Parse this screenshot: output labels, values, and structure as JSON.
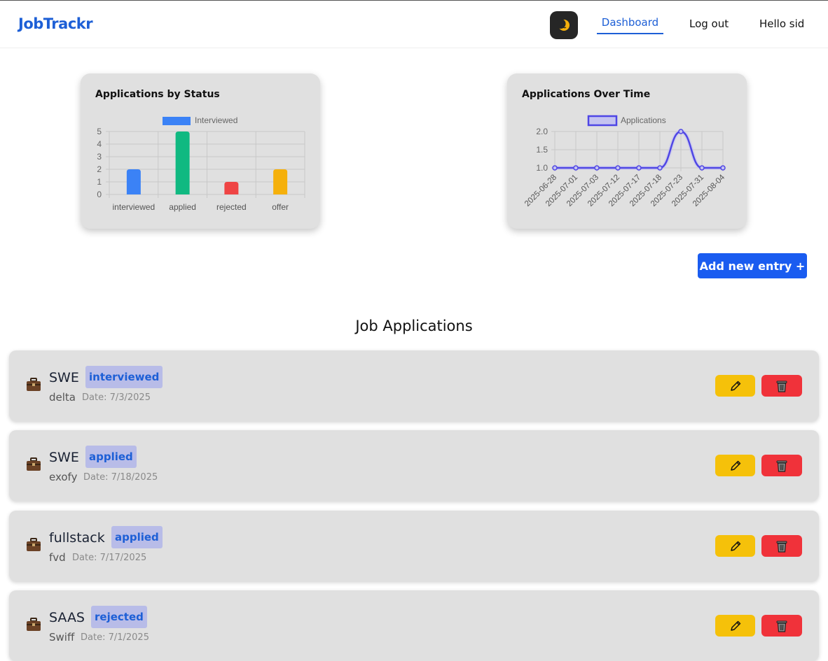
{
  "app": {
    "brand": "JobTrackr"
  },
  "nav": {
    "theme_icon": "moon-icon",
    "dashboard": "Dashboard",
    "logout": "Log out",
    "greeting": "Hello sid"
  },
  "charts": {
    "status_title": "Applications by Status",
    "time_title": "Applications Over Time"
  },
  "chart_data": [
    {
      "type": "bar",
      "title": "Applications by Status",
      "legend": "Interviewed",
      "legend_position": "top",
      "categories": [
        "interviewed",
        "applied",
        "rejected",
        "offer"
      ],
      "values": [
        2,
        5,
        1,
        2
      ],
      "colors": [
        "#3b82f6",
        "#10b981",
        "#ef4444",
        "#f5b00b"
      ],
      "ylim": [
        0,
        5
      ],
      "yticks": [
        "0",
        "1",
        "2",
        "3",
        "4",
        "5"
      ],
      "grid": true
    },
    {
      "type": "line",
      "title": "Applications Over Time",
      "legend": "Applications",
      "legend_position": "top",
      "x": [
        "2025-06-28",
        "2025-07-01",
        "2025-07-03",
        "2025-07-12",
        "2025-07-17",
        "2025-07-18",
        "2025-07-23",
        "2025-07-31",
        "2025-08-04"
      ],
      "values": [
        1,
        1,
        1,
        1,
        1,
        1,
        2,
        1,
        1
      ],
      "ylim": [
        1,
        2
      ],
      "yticks": [
        "1.0",
        "1.5",
        "2.0"
      ],
      "color": "#4f46e5",
      "grid": true
    }
  ],
  "actions": {
    "add_entry": "Add new entry +"
  },
  "section": {
    "title": "Job Applications"
  },
  "jobs": [
    {
      "title": "SWE",
      "status": "interviewed",
      "company": "delta",
      "date": "Date: 7/3/2025"
    },
    {
      "title": "SWE",
      "status": "applied",
      "company": "exofy",
      "date": "Date: 7/18/2025"
    },
    {
      "title": "fullstack",
      "status": "applied",
      "company": "fvd",
      "date": "Date: 7/17/2025"
    },
    {
      "title": "SAAS",
      "status": "rejected",
      "company": "Swiff",
      "date": "Date: 7/1/2025"
    }
  ],
  "icons": {
    "job": "briefcase-icon",
    "edit": "pencil-icon",
    "delete": "trash-icon"
  },
  "colors": {
    "brand": "#1d5fd6",
    "add_button": "#1a5cf0",
    "edit_button": "#f5c10a",
    "delete_button": "#f0323a",
    "badge_bg": "#b8bce8"
  }
}
